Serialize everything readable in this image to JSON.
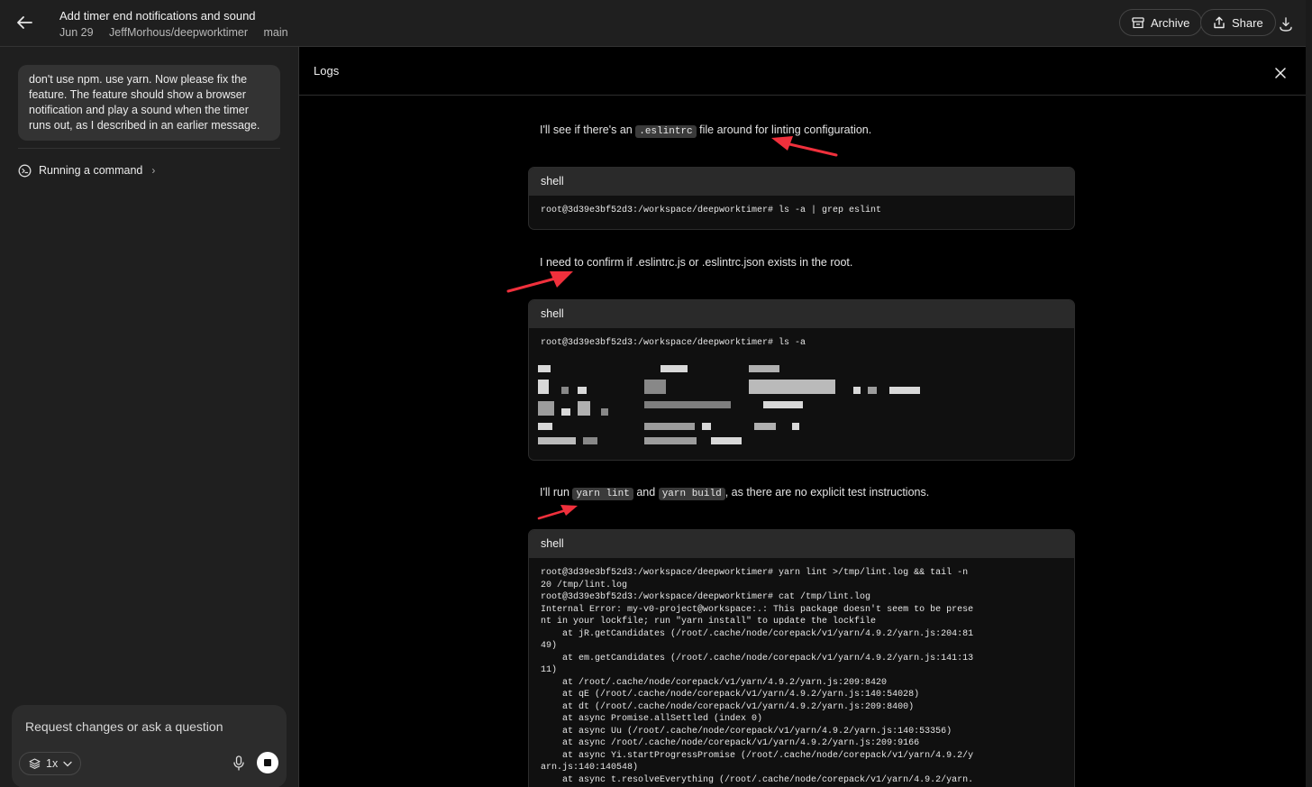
{
  "header": {
    "title": "Add timer end notifications and sound",
    "date": "Jun 29",
    "repo": "JeffMorhous/deepworktimer",
    "branch": "main",
    "archive_label": "Archive",
    "share_label": "Share"
  },
  "sidebar": {
    "user_message": "don't use npm. use yarn. Now please fix the feature. The feature should show a browser notification and play a sound when the timer runs out, as I described in an earlier message.",
    "status_item": "Running a command",
    "composer": {
      "placeholder": "Request changes or ask a question",
      "speed_label": "1x"
    }
  },
  "logs": {
    "title": "Logs",
    "messages": [
      {
        "before": "I'll see if there's an",
        "code": ".eslintrc",
        "after": "file around for linting configuration."
      },
      {
        "text": "I need to confirm if .eslintrc.js or .eslintrc.json exists in the root."
      },
      {
        "before": "I'll run",
        "code1": "yarn lint",
        "mid": "and",
        "code2": "yarn build",
        "after": ", as there are no explicit test instructions."
      }
    ],
    "shells": [
      {
        "label": "shell",
        "output": "root@3d39e3bf52d3:/workspace/deepworktimer# ls -a | grep eslint"
      },
      {
        "label": "shell",
        "output": "root@3d39e3bf52d3:/workspace/deepworktimer# ls -a"
      },
      {
        "label": "shell",
        "output": "root@3d39e3bf52d3:/workspace/deepworktimer# yarn lint >/tmp/lint.log && tail -n\n20 /tmp/lint.log\nroot@3d39e3bf52d3:/workspace/deepworktimer# cat /tmp/lint.log\nInternal Error: my-v0-project@workspace:.: This package doesn't seem to be prese\nnt in your lockfile; run \"yarn install\" to update the lockfile\n    at jR.getCandidates (/root/.cache/node/corepack/v1/yarn/4.9.2/yarn.js:204:81\n49)\n    at em.getCandidates (/root/.cache/node/corepack/v1/yarn/4.9.2/yarn.js:141:13\n11)\n    at /root/.cache/node/corepack/v1/yarn/4.9.2/yarn.js:209:8420\n    at qE (/root/.cache/node/corepack/v1/yarn/4.9.2/yarn.js:140:54028)\n    at dt (/root/.cache/node/corepack/v1/yarn/4.9.2/yarn.js:209:8400)\n    at async Promise.allSettled (index 0)\n    at async Uu (/root/.cache/node/corepack/v1/yarn/4.9.2/yarn.js:140:53356)\n    at async /root/.cache/node/corepack/v1/yarn/4.9.2/yarn.js:209:9166\n    at async Yi.startProgressPromise (/root/.cache/node/corepack/v1/yarn/4.9.2/y\narn.js:140:140548)\n    at async t.resolveEverything (/root/.cache/node/corepack/v1/yarn/4.9.2/yarn."
      }
    ]
  },
  "colors": {
    "annotation_arrow": "#f0303c",
    "background": "#000000",
    "sidebar": "#1f1f1f"
  }
}
